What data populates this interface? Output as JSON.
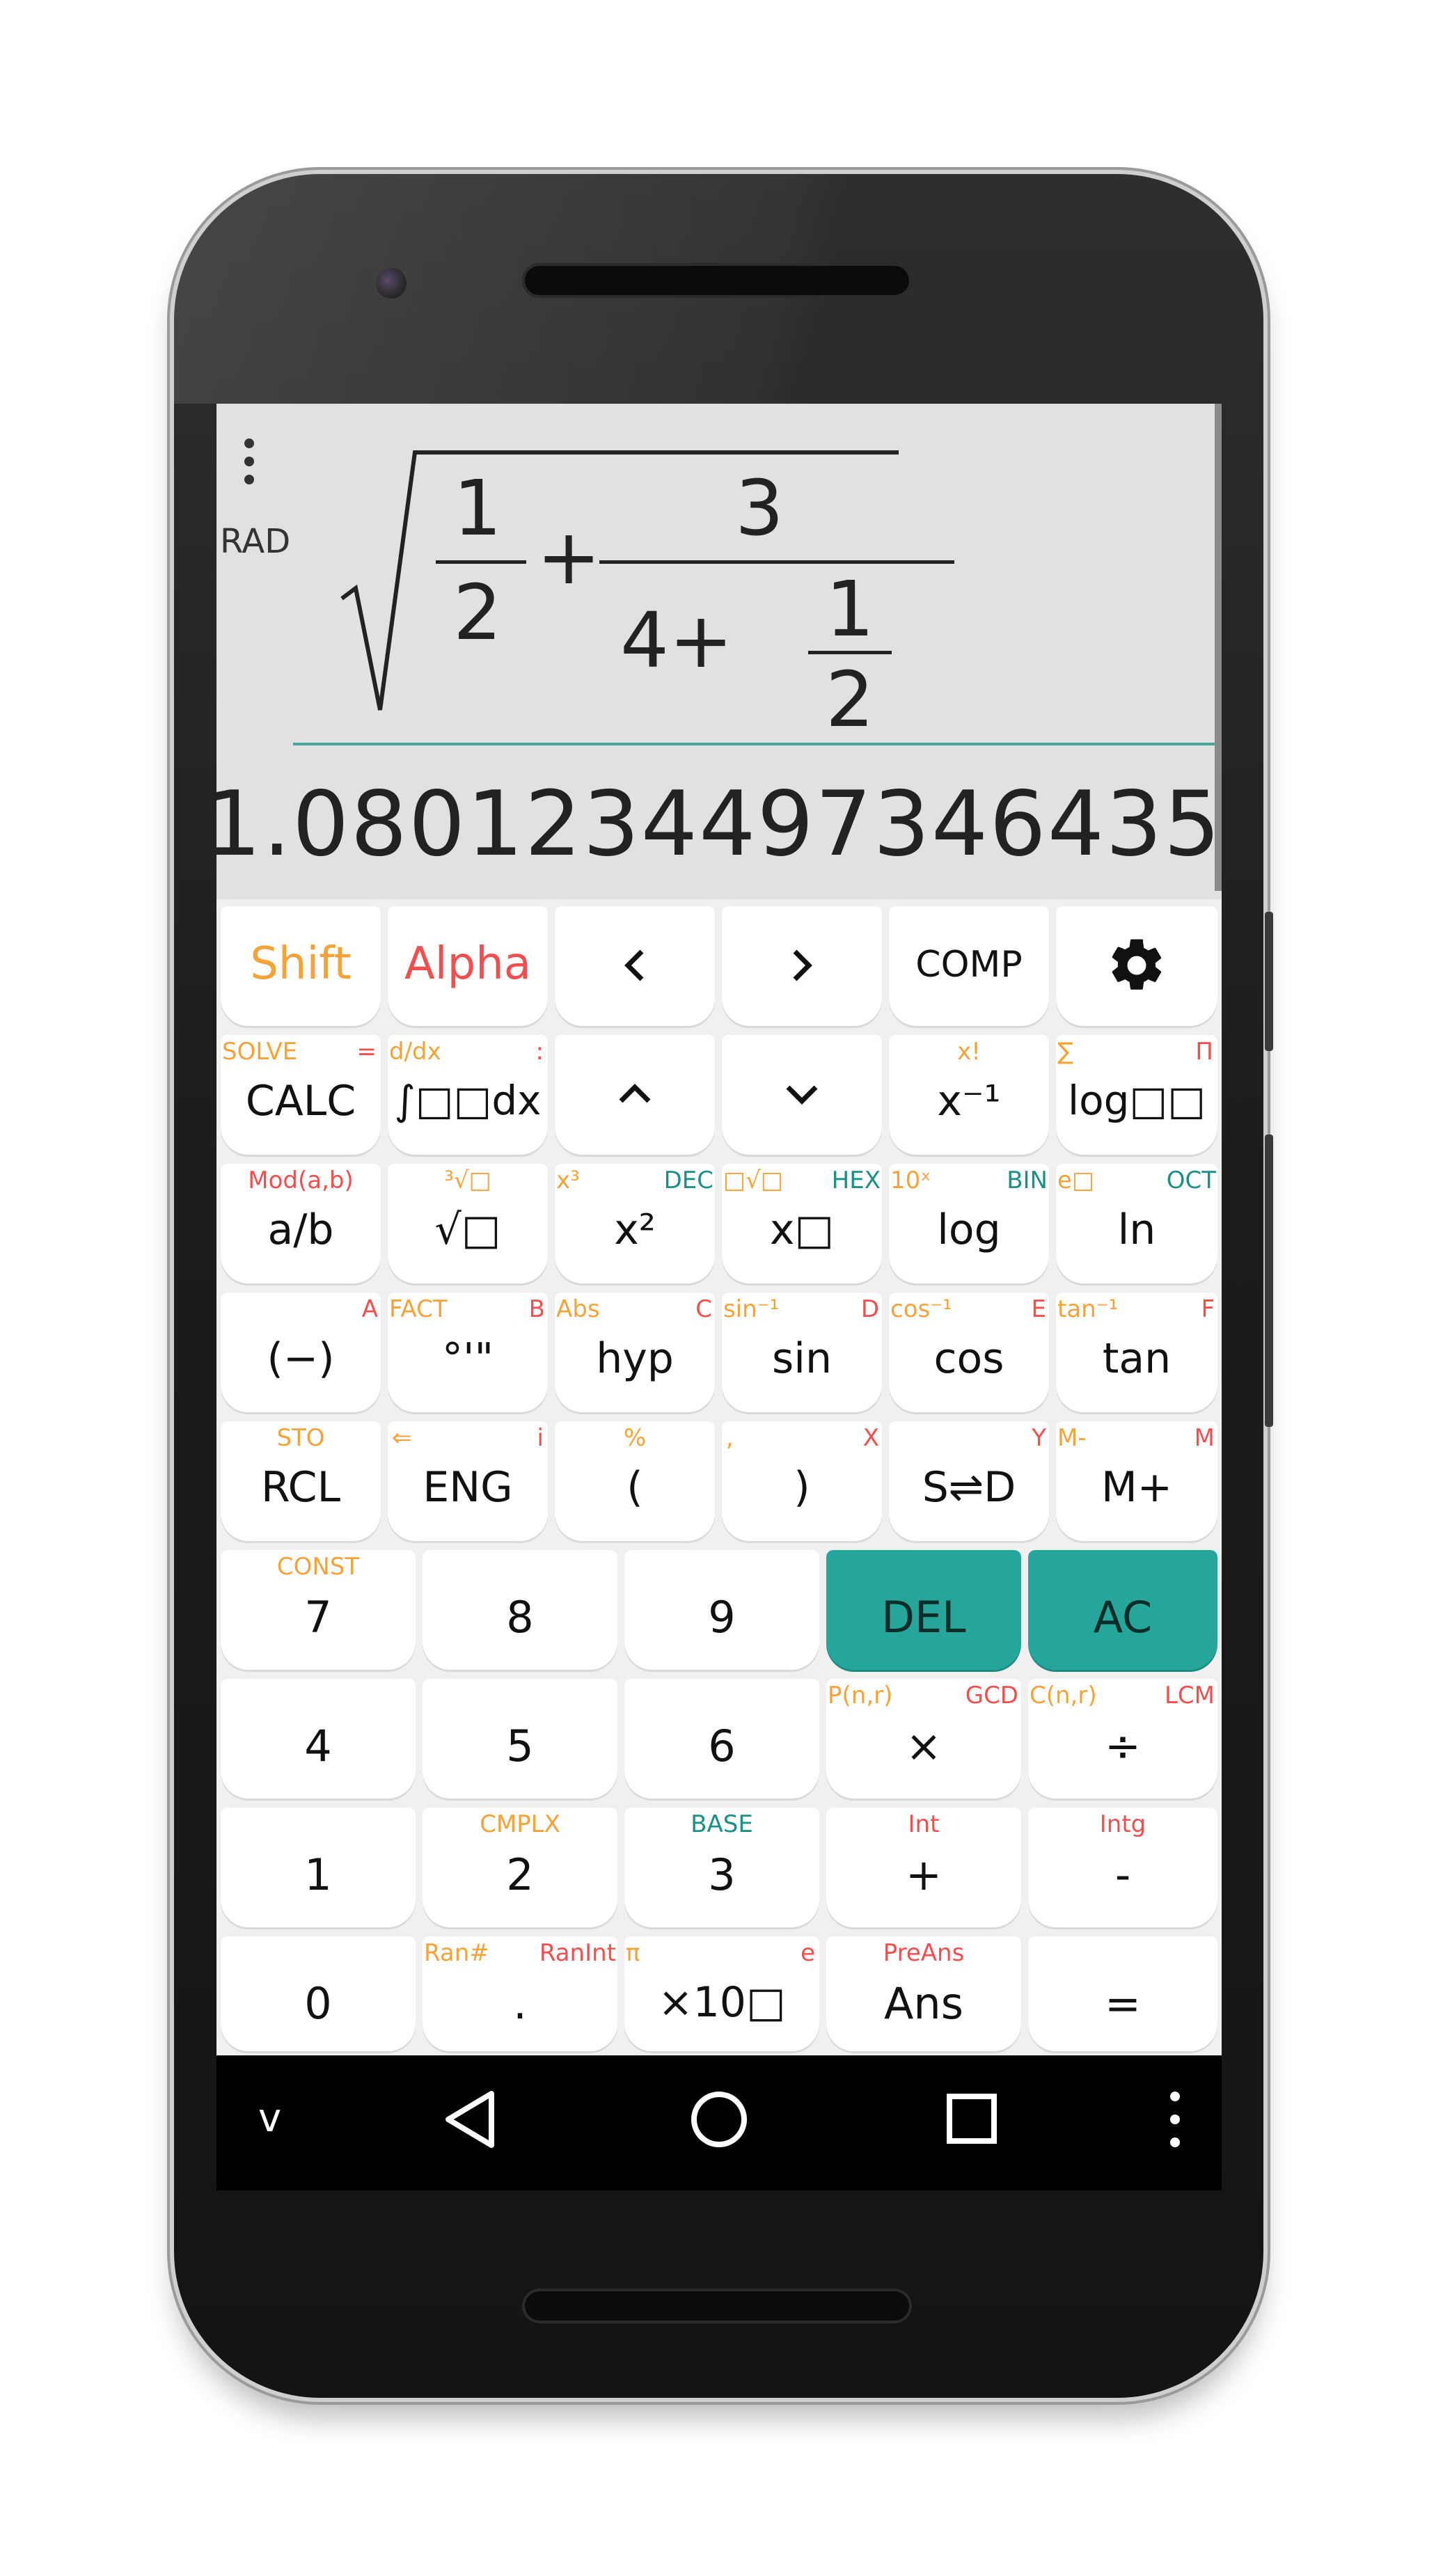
{
  "display": {
    "mode": "RAD",
    "expression": {
      "num1": "1",
      "den1": "2",
      "plus": "+",
      "num2": "3",
      "inner": "4+",
      "num3": "1",
      "den3": "2"
    },
    "result": "1.0801234497346435"
  },
  "row1": {
    "shift": "Shift",
    "alpha": "Alpha",
    "left": "<",
    "right": ">",
    "comp": "COMP",
    "settings_icon": "gear-icon"
  },
  "row2": [
    {
      "main": "CALC",
      "s1": "SOLVE",
      "s2": "="
    },
    {
      "main": "∫□□dx",
      "s1": "d/dx",
      "s2": ":"
    },
    {
      "main": "⌃"
    },
    {
      "main": "⌄"
    },
    {
      "main": "x⁻¹",
      "s1": "x!"
    },
    {
      "main": "log□□",
      "s1": "∑",
      "s2": "Π"
    }
  ],
  "row3": [
    {
      "main": "a/b",
      "s1": "Mod(a,b)"
    },
    {
      "main": "√□",
      "s1": "³√□"
    },
    {
      "main": "x²",
      "s1": "x³",
      "s2": "DEC"
    },
    {
      "main": "x□",
      "s1": "□√□",
      "s2": "HEX"
    },
    {
      "main": "log",
      "s1": "10ˣ",
      "s2": "BIN"
    },
    {
      "main": "ln",
      "s1": "e□",
      "s2": "OCT"
    }
  ],
  "row4": [
    {
      "main": "(−)",
      "s2": "A"
    },
    {
      "main": "°'\"",
      "s1": "FACT",
      "s2": "B"
    },
    {
      "main": "hyp",
      "s1": "Abs",
      "s2": "C"
    },
    {
      "main": "sin",
      "s1": "sin⁻¹",
      "s2": "D"
    },
    {
      "main": "cos",
      "s1": "cos⁻¹",
      "s2": "E"
    },
    {
      "main": "tan",
      "s1": "tan⁻¹",
      "s2": "F"
    }
  ],
  "row5": [
    {
      "main": "RCL",
      "s1": "STO"
    },
    {
      "main": "ENG",
      "s1": "⇐",
      "s2": "i"
    },
    {
      "main": "(",
      "s1": "%"
    },
    {
      "main": ")",
      "s1": ",",
      "s2": "X"
    },
    {
      "main": "S⇌D",
      "s2": "Y"
    },
    {
      "main": "M+",
      "s1": "M-",
      "s2": "M"
    }
  ],
  "num1": [
    {
      "main": "7",
      "s1": "CONST"
    },
    {
      "main": "8"
    },
    {
      "main": "9"
    },
    {
      "main": "DEL"
    },
    {
      "main": "AC"
    }
  ],
  "num2": [
    {
      "main": "4"
    },
    {
      "main": "5"
    },
    {
      "main": "6"
    },
    {
      "main": "×",
      "s1": "P(n,r)",
      "s2": "GCD"
    },
    {
      "main": "÷",
      "s1": "C(n,r)",
      "s2": "LCM"
    }
  ],
  "num3": [
    {
      "main": "1"
    },
    {
      "main": "2",
      "s1": "CMPLX"
    },
    {
      "main": "3",
      "s1": "BASE"
    },
    {
      "main": "+",
      "s1": "Int"
    },
    {
      "main": "-",
      "s1": "Intg"
    }
  ],
  "num4": [
    {
      "main": "0"
    },
    {
      "main": ".",
      "s1": "Ran#",
      "s2": "RanInt"
    },
    {
      "main": "×10□",
      "s1": "π",
      "s2": "e"
    },
    {
      "main": "Ans",
      "s1": "PreAns"
    },
    {
      "main": "="
    }
  ],
  "navbar": {
    "collapse": "v",
    "icons": [
      "back-icon",
      "home-icon",
      "recents-icon",
      "overflow-menu-icon"
    ]
  }
}
